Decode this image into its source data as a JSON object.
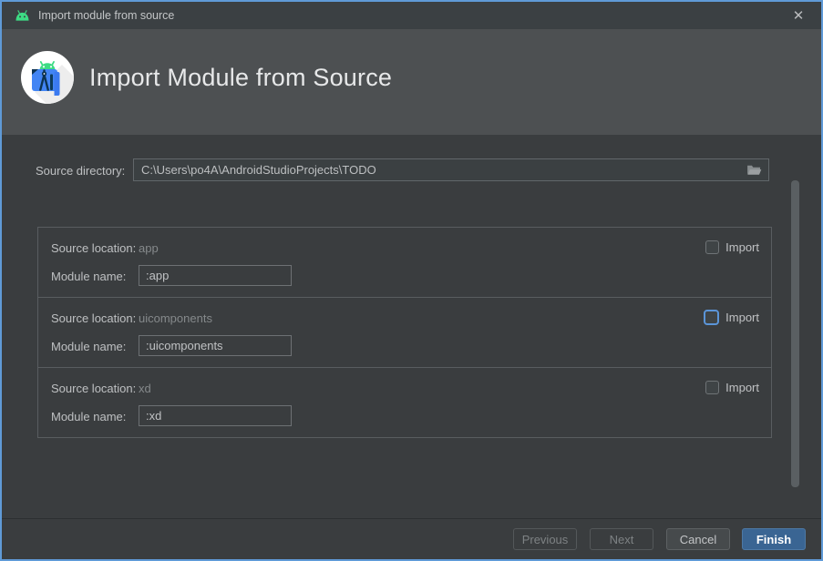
{
  "window": {
    "title": "Import module from source",
    "close_glyph": "✕"
  },
  "header": {
    "title": "Import Module from Source"
  },
  "source_directory": {
    "label": "Source directory:",
    "value": "C:\\Users\\po4A\\AndroidStudioProjects\\TODO"
  },
  "modules": {
    "source_location_label": "Source location:",
    "module_name_label": "Module name:",
    "import_label": "Import",
    "rows": [
      {
        "source_location": "app",
        "module_name": ":app",
        "import_checked": false,
        "focused": false
      },
      {
        "source_location": "uicomponents",
        "module_name": ":uicomponents",
        "import_checked": false,
        "focused": true
      },
      {
        "source_location": "xd",
        "module_name": ":xd",
        "import_checked": false,
        "focused": false
      }
    ]
  },
  "footer": {
    "previous": "Previous",
    "next": "Next",
    "cancel": "Cancel",
    "finish": "Finish"
  },
  "colors": {
    "window_border": "#5f9ad7",
    "titlebar_bg": "#3b4043",
    "header_bg": "#4d5052",
    "content_bg": "#3a3d3f",
    "focus_blue": "#5b95d8",
    "primary_button_blue": "#3a6593",
    "android_green": "#3ddc84",
    "logo_blue": "#4285f4"
  }
}
